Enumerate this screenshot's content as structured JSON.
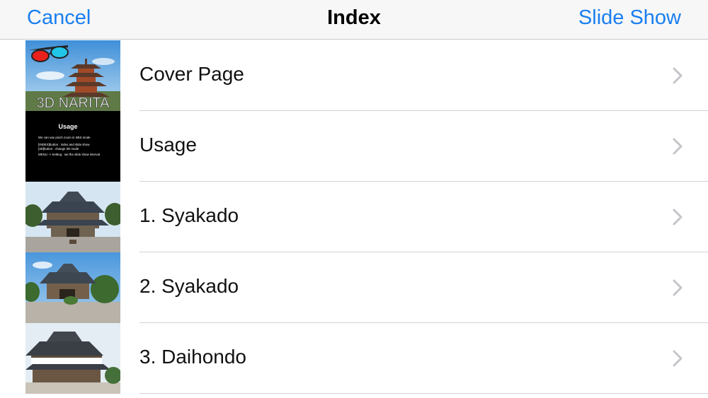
{
  "nav": {
    "cancel_label": "Cancel",
    "title": "Index",
    "slideshow_label": "Slide Show"
  },
  "rows": [
    {
      "label": "Cover Page",
      "thumb_text": "3D NARITA"
    },
    {
      "label": "Usage",
      "thumb_title": "Usage",
      "thumb_lines": [
        "We can use pinch zoom in SBS mode",
        "[INDEX]button : index and slide show",
        "[3D]button : change 3D mode",
        "MENU -> Setting : set the slide show interval"
      ]
    },
    {
      "label": "1. Syakado"
    },
    {
      "label": "2. Syakado"
    },
    {
      "label": "3. Daihondo"
    }
  ],
  "colors": {
    "accent": "#1a7ff0",
    "separator": "#d3d3d8"
  },
  "icons": {
    "row_disclosure": "chevron-right-icon",
    "cover_glasses": "3d-glasses-icon"
  }
}
